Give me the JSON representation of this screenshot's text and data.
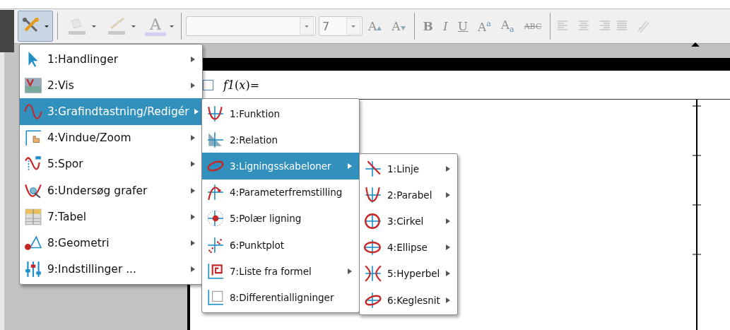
{
  "toolbar": {
    "tools_button": {
      "pressed": true
    },
    "color_buttons": [
      {
        "kind": "fill",
        "disabled": true
      },
      {
        "kind": "line",
        "disabled": true
      },
      {
        "kind": "text",
        "label": "A",
        "disabled": true
      }
    ],
    "size_field": {
      "value": "7"
    },
    "size_buttons": [
      {
        "kind": "grow",
        "label": "A"
      },
      {
        "kind": "shrink",
        "label": "A"
      }
    ],
    "style_buttons": [
      {
        "kind": "bold",
        "label": "B"
      },
      {
        "kind": "italic",
        "label": "I"
      },
      {
        "kind": "underline",
        "label": "U"
      },
      {
        "kind": "super",
        "label": "A$^{a}$"
      },
      {
        "kind": "sub",
        "label": "A$_{a}$"
      },
      {
        "kind": "strike",
        "label": "ABC"
      }
    ],
    "align_buttons": [
      {
        "kind": "left"
      },
      {
        "kind": "center"
      },
      {
        "kind": "right"
      },
      {
        "kind": "justify"
      },
      {
        "kind": "link"
      }
    ]
  },
  "entry_line": {
    "checked": false,
    "label": "*f1*(*x*)="
  },
  "menu": [
    {
      "label": "1:Handlinger",
      "submenu": true,
      "selected": false
    },
    {
      "label": "2:Vis",
      "submenu": true,
      "selected": false
    },
    {
      "label": "3:Grafindtastning/Redigér",
      "submenu": true,
      "selected": true
    },
    {
      "label": "4:Vindue/Zoom",
      "submenu": true,
      "selected": false
    },
    {
      "label": "5:Spor",
      "submenu": true,
      "selected": false
    },
    {
      "label": "6:Undersøg grafer",
      "submenu": true,
      "selected": false
    },
    {
      "label": "7:Tabel",
      "submenu": true,
      "selected": false
    },
    {
      "label": "8:Geometri",
      "submenu": true,
      "selected": false
    },
    {
      "label": "9:Indstillinger ...",
      "submenu": true,
      "selected": false
    }
  ],
  "submenu": [
    {
      "label": "1:Funktion",
      "submenu": false,
      "selected": false
    },
    {
      "label": "2:Relation",
      "submenu": false,
      "selected": false
    },
    {
      "label": "3:Ligningsskabeloner",
      "submenu": true,
      "selected": true
    },
    {
      "label": "4:Parameterfremstilling",
      "submenu": false,
      "selected": false
    },
    {
      "label": "5:Polær ligning",
      "submenu": false,
      "selected": false
    },
    {
      "label": "6:Punktplot",
      "submenu": false,
      "selected": false
    },
    {
      "label": "7:Liste fra formel",
      "submenu": true,
      "selected": false
    },
    {
      "label": "8:Differentialligninger",
      "submenu": false,
      "selected": false
    }
  ],
  "subsubmenu": [
    {
      "label": "1:Linje",
      "submenu": true,
      "selected": false
    },
    {
      "label": "2:Parabel",
      "submenu": true,
      "selected": false
    },
    {
      "label": "3:Cirkel",
      "submenu": true,
      "selected": false
    },
    {
      "label": "4:Ellipse",
      "submenu": true,
      "selected": false
    },
    {
      "label": "5:Hyperbel",
      "submenu": true,
      "selected": false
    },
    {
      "label": "6:Keglesnit",
      "submenu": true,
      "selected": false
    }
  ]
}
